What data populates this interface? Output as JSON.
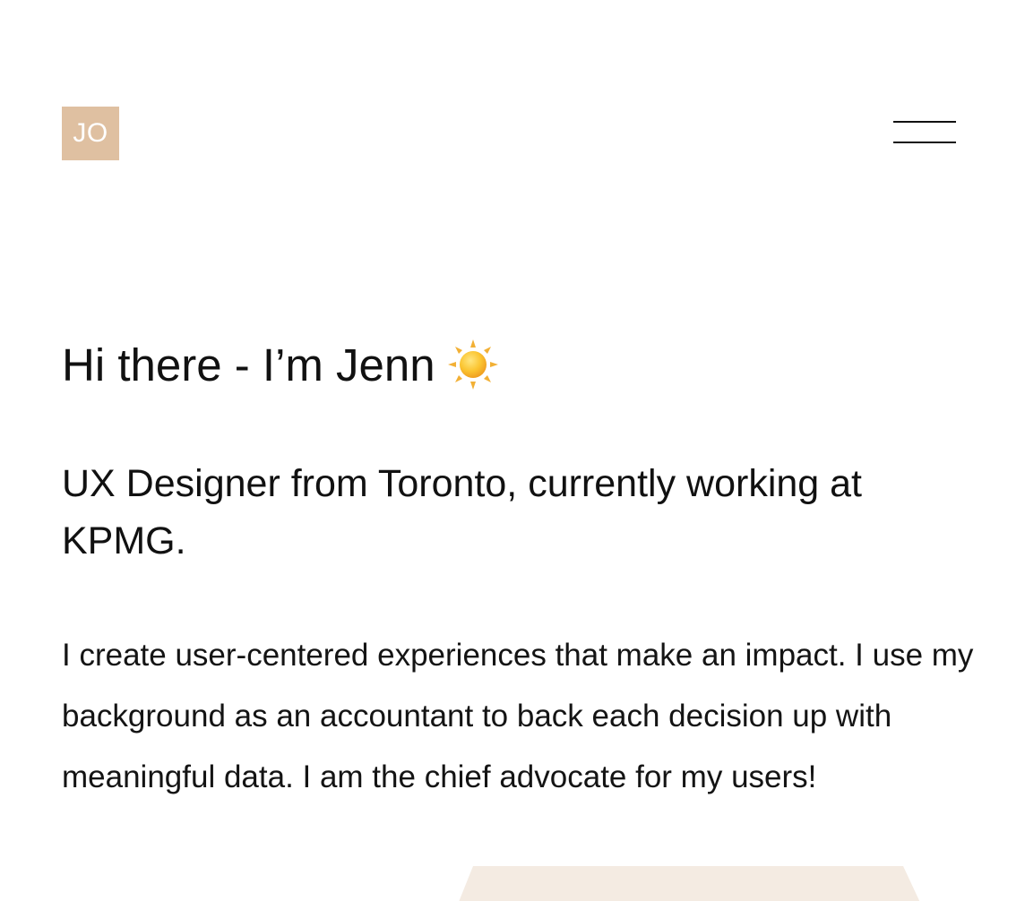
{
  "header": {
    "logo_text": "JO",
    "logo_color": "#dfc0a1",
    "menu_icon": "hamburger-menu-icon"
  },
  "hero": {
    "greeting": "Hi there - I’m Jenn",
    "greeting_icon": "sun-icon",
    "subtitle": "UX Designer from Toronto, currently working at KPMG.",
    "intro": "I create user-centered experiences that make an impact. I use my background as an accountant to back each decision up with meaningful data. I am the chief advocate for my users!"
  },
  "colors": {
    "accent": "#dfc0a1",
    "decor_beige": "#f4ebe2",
    "text": "#111111",
    "background": "#ffffff"
  }
}
